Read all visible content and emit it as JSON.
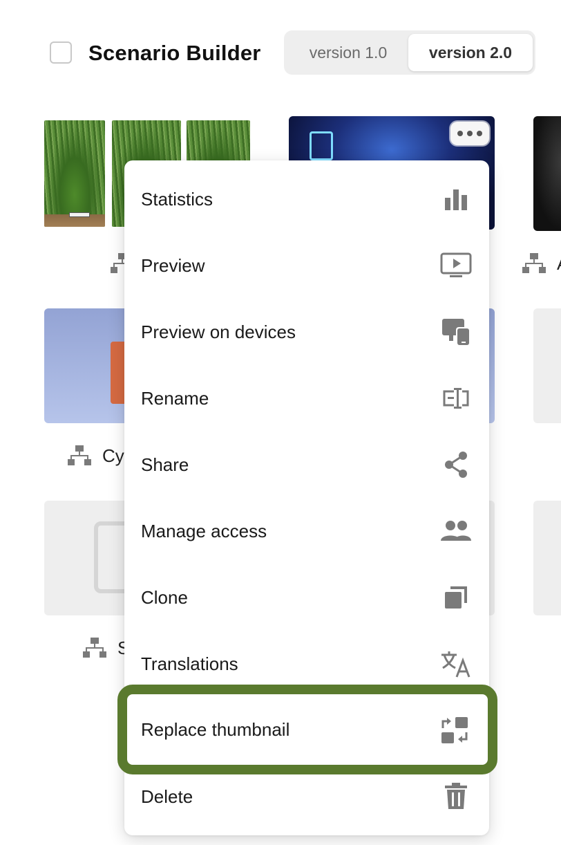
{
  "header": {
    "title": "Scenario Builder",
    "versions": [
      {
        "label": "version 1.0",
        "selected": false
      },
      {
        "label": "version 2.0",
        "selected": true
      }
    ]
  },
  "cards": {
    "row2_col1_caption": "Cy",
    "row3_col1_caption": "S",
    "row1_col3_caption": "A"
  },
  "menu": {
    "items": [
      {
        "label": "Statistics",
        "icon": "bar-chart-icon"
      },
      {
        "label": "Preview",
        "icon": "play-screen-icon"
      },
      {
        "label": "Preview on devices",
        "icon": "devices-icon"
      },
      {
        "label": "Rename",
        "icon": "rename-cursor-icon"
      },
      {
        "label": "Share",
        "icon": "share-icon"
      },
      {
        "label": "Manage access",
        "icon": "people-icon"
      },
      {
        "label": "Clone",
        "icon": "clone-icon"
      },
      {
        "label": "Translations",
        "icon": "translate-icon"
      },
      {
        "label": "Replace thumbnail",
        "icon": "swap-image-icon",
        "highlighted": true
      },
      {
        "label": "Delete",
        "icon": "trash-icon"
      }
    ]
  },
  "colors": {
    "icon_gray": "#7a7a7a",
    "highlight_green": "#5a7a2e",
    "toggle_bg": "#eeeeee"
  }
}
